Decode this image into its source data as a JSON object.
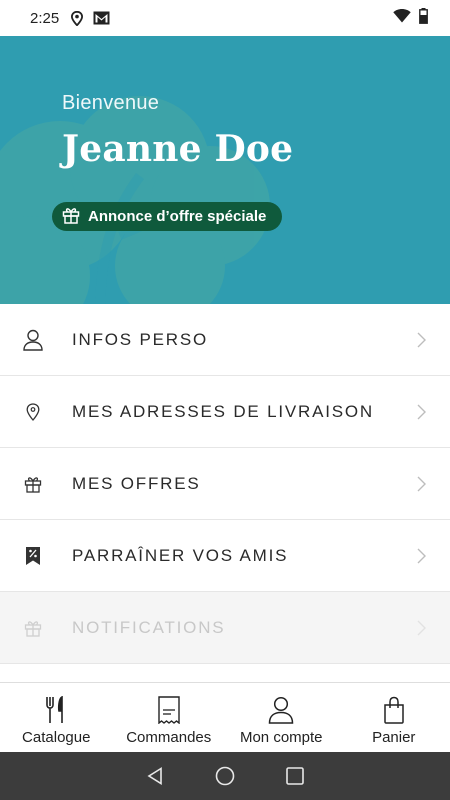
{
  "status_bar": {
    "time": "2:25",
    "icons": [
      "location-icon",
      "gmail-icon",
      "wifi-icon",
      "battery-icon"
    ]
  },
  "hero": {
    "greeting": "Bienvenue",
    "username": "Jeanne Doe",
    "offer_button": "Annonce d’offre spéciale",
    "background_color": "#2f9db0",
    "pill_color": "#0f5a3c"
  },
  "menu": {
    "items": [
      {
        "label": "INFOS PERSO",
        "icon": "person-icon"
      },
      {
        "label": "MES ADRESSES DE LIVRAISON",
        "icon": "location-pin-icon"
      },
      {
        "label": "MES OFFRES",
        "icon": "gift-icon"
      },
      {
        "label": "PARRAÎNER VOS AMIS",
        "icon": "referral-tag-icon"
      },
      {
        "label": "NOTIFICATIONS",
        "icon": "gift-icon",
        "disabled": true
      }
    ]
  },
  "bottom_nav": {
    "items": [
      {
        "label": "Catalogue",
        "icon": "fork-knife-icon"
      },
      {
        "label": "Commandes",
        "icon": "receipt-icon"
      },
      {
        "label": "Mon compte",
        "icon": "person-icon",
        "active": true
      },
      {
        "label": "Panier",
        "icon": "shopping-bag-icon"
      }
    ]
  },
  "system_nav": {
    "buttons": [
      "back-icon",
      "home-icon",
      "recents-icon"
    ]
  }
}
